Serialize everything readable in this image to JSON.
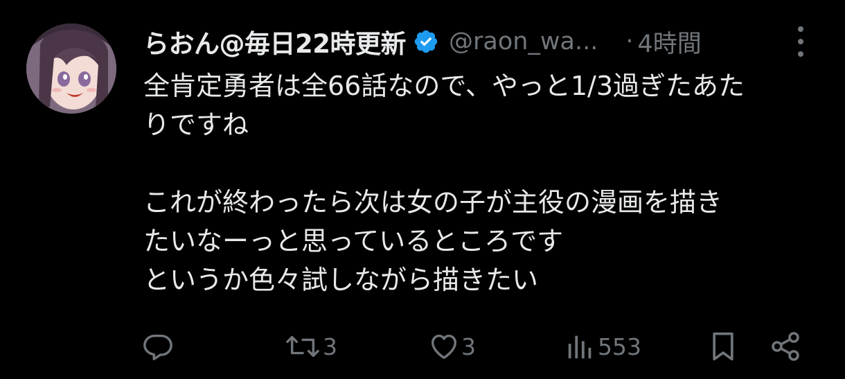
{
  "tweet": {
    "display_name": "らおん@毎日22時更新",
    "handle": "@raon_wa...",
    "separator": "·",
    "time": "4時間",
    "body_lines": [
      "全肯定勇者は全66話なので、やっと1/3過ぎたあた",
      "りですね",
      "",
      "これが終わったら次は女の子が主役の漫画を描き",
      "たいなーっと思っているところです",
      "というか色々試しながら描きたい"
    ],
    "actions": {
      "reply_count": "",
      "retweet_count": "3",
      "like_count": "3",
      "views_count": "553"
    }
  },
  "icons": {
    "verified": "verified-badge-icon",
    "more": "more-dots-icon",
    "reply": "reply-bubble-icon",
    "retweet": "retweet-icon",
    "like": "heart-icon",
    "views": "views-bar-icon",
    "bookmark": "bookmark-icon",
    "share": "share-icon"
  },
  "colors": {
    "background": "#000000",
    "text_primary": "#e7e9ea",
    "text_secondary": "#71767b",
    "verified_blue": "#1d9bf0"
  }
}
